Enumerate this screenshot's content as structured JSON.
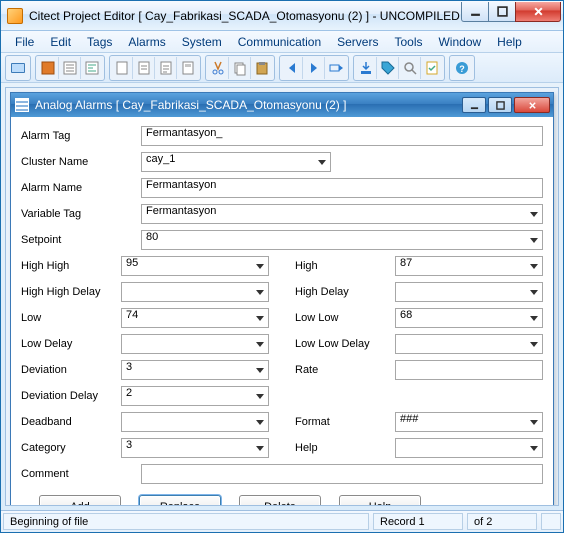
{
  "window": {
    "title": "Citect Project Editor [ Cay_Fabrikasi_SCADA_Otomasyonu (2) ] - UNCOMPILED"
  },
  "menu": {
    "items": [
      "File",
      "Edit",
      "Tags",
      "Alarms",
      "System",
      "Communication",
      "Servers",
      "Tools",
      "Window",
      "Help"
    ]
  },
  "inner": {
    "title": "Analog Alarms [ Cay_Fabrikasi_SCADA_Otomasyonu (2) ]"
  },
  "labels": {
    "alarm_tag": "Alarm Tag",
    "cluster_name": "Cluster Name",
    "alarm_name": "Alarm Name",
    "variable_tag": "Variable Tag",
    "setpoint": "Setpoint",
    "high_high": "High High",
    "high_high_delay": "High High Delay",
    "low": "Low",
    "low_delay": "Low Delay",
    "deviation": "Deviation",
    "deviation_delay": "Deviation Delay",
    "deadband": "Deadband",
    "category": "Category",
    "comment": "Comment",
    "high": "High",
    "high_delay": "High Delay",
    "low_low": "Low Low",
    "low_low_delay": "Low Low Delay",
    "rate": "Rate",
    "format": "Format",
    "help": "Help"
  },
  "values": {
    "alarm_tag": "Fermantasyon_",
    "cluster_name": "cay_1",
    "alarm_name": "Fermantasyon",
    "variable_tag": "Fermantasyon",
    "setpoint": "80",
    "high_high": "95",
    "high_high_delay": "",
    "low": "74",
    "low_delay": "",
    "deviation": "3",
    "deviation_delay": "2",
    "deadband": "",
    "category": "3",
    "comment": "",
    "high": "87",
    "high_delay": "",
    "low_low": "68",
    "low_low_delay": "",
    "rate": "",
    "format": "###",
    "help": ""
  },
  "buttons": {
    "add": "Add",
    "replace": "Replace",
    "delete": "Delete",
    "help": "Help"
  },
  "status": {
    "left": "Beginning of file",
    "record": "Record 1",
    "of": "of 2"
  }
}
